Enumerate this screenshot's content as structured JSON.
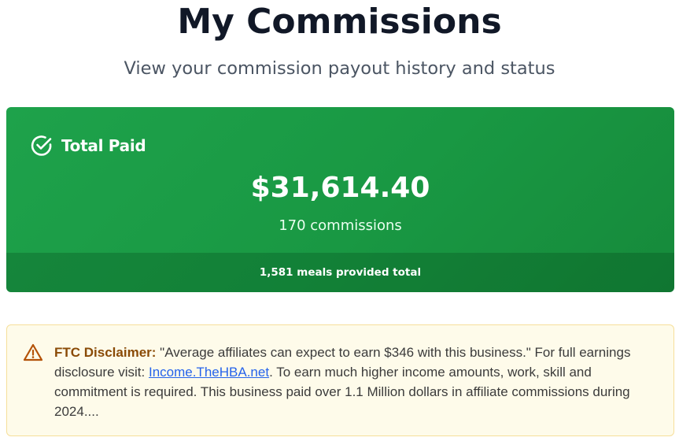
{
  "header": {
    "title": "My Commissions",
    "subtitle": "View your commission payout history and status"
  },
  "total_card": {
    "icon": "check-circle-icon",
    "label": "Total Paid",
    "amount": "$31,614.40",
    "count": "170 commissions",
    "footer": "1,581 meals provided total",
    "color": "#1ea24b"
  },
  "disclaimer": {
    "icon": "warning-icon",
    "label": "FTC Disclaimer:",
    "text_before_link": " \"Average affiliates can expect to earn $346 with this business.\" For full earnings disclosure visit: ",
    "link_text": "Income.TheHBA.net",
    "text_after_link": ". To earn much higher income amounts, work, skill and commitment is required. This business paid over 1.1 Million dollars in affiliate commissions during 2024....",
    "accent_color": "#8a4b07"
  }
}
